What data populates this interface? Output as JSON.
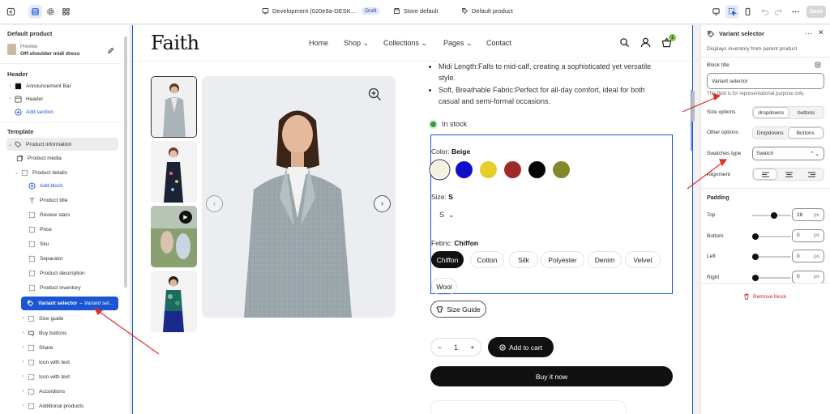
{
  "topbar": {
    "store_name": "Development (020e9a-DESK…",
    "draft_badge": "Draft",
    "theme": "Store default",
    "template": "Default product",
    "save_label": "Save"
  },
  "left": {
    "panel_title": "Default product",
    "preview_label": "Preview",
    "preview_product": "Off-shoulder midi dress",
    "header_section_title": "Header",
    "header_items": [
      "Announcement Bar",
      "Header"
    ],
    "add_section": "Add section",
    "template_section_title": "Template",
    "product_information": "Product information",
    "product_media": "Product media",
    "product_details": "Product details",
    "add_block": "Add block",
    "detail_blocks": [
      "Product title",
      "Review stars",
      "Price",
      "Sku",
      "Separator",
      "Product description",
      "Product inventory"
    ],
    "selected_block": "Variant selector",
    "selected_block_sub": "– Variant sel…",
    "after_blocks": [
      "Size guide",
      "Buy buttons",
      "Share",
      "Icon with text",
      "Icon with text",
      "Accordions",
      "Additional products"
    ]
  },
  "canvas": {
    "logo": "Faith",
    "nav": [
      "Home",
      "Shop",
      "Collections",
      "Pages",
      "Contact"
    ],
    "cart_count": "1",
    "bullets": [
      "Midi Length:Falls to mid-calf, creating a sophisticated yet versatile style.",
      "Soft, Breathable Fabric:Perfect for all-day comfort, ideal for both casual and semi-formal occasions."
    ],
    "stock": "In stock",
    "color_label": "Color: ",
    "color_value": "Beige",
    "colors": [
      "#f3f1e0",
      "#1010c8",
      "#e6cd28",
      "#9f2a2a",
      "#050505",
      "#86862a"
    ],
    "size_label": "Size: ",
    "size_value": "S",
    "size_dropdown": "S",
    "fabric_label": "Febric: ",
    "fabric_value": "Chiffon",
    "fabrics": [
      "Chiffon",
      "Cotton",
      "Silk",
      "Polyester",
      "Denim",
      "Velvet",
      "Wool"
    ],
    "size_guide": "Size Guide",
    "quantity": "1",
    "add_to_cart": "Add to cart",
    "buy_now": "Buy it now"
  },
  "right": {
    "title": "Variant selector",
    "subtitle": "Displays inventory from parent product",
    "block_title_label": "Block title",
    "block_title_value": "Variant selector",
    "block_title_hint": "This field is for representational purpose only.",
    "size_options_label": "Size options",
    "size_options": [
      "dropdowns",
      "buttons"
    ],
    "other_options_label": "Other options",
    "other_options": [
      "Dropdowns",
      "Buttons"
    ],
    "swatches_type_label": "Swatches type",
    "swatches_type_value": "Swatch",
    "alignment_label": "Alignment",
    "padding_title": "Padding",
    "padding": [
      {
        "label": "Top",
        "value": "28",
        "unit": "px",
        "level": 0.58
      },
      {
        "label": "Bottom",
        "value": "0",
        "unit": "px",
        "level": 0
      },
      {
        "label": "Left",
        "value": "0",
        "unit": "px",
        "level": 0
      },
      {
        "label": "Right",
        "value": "0",
        "unit": "px",
        "level": 0
      }
    ],
    "remove_block": "Remove block"
  }
}
